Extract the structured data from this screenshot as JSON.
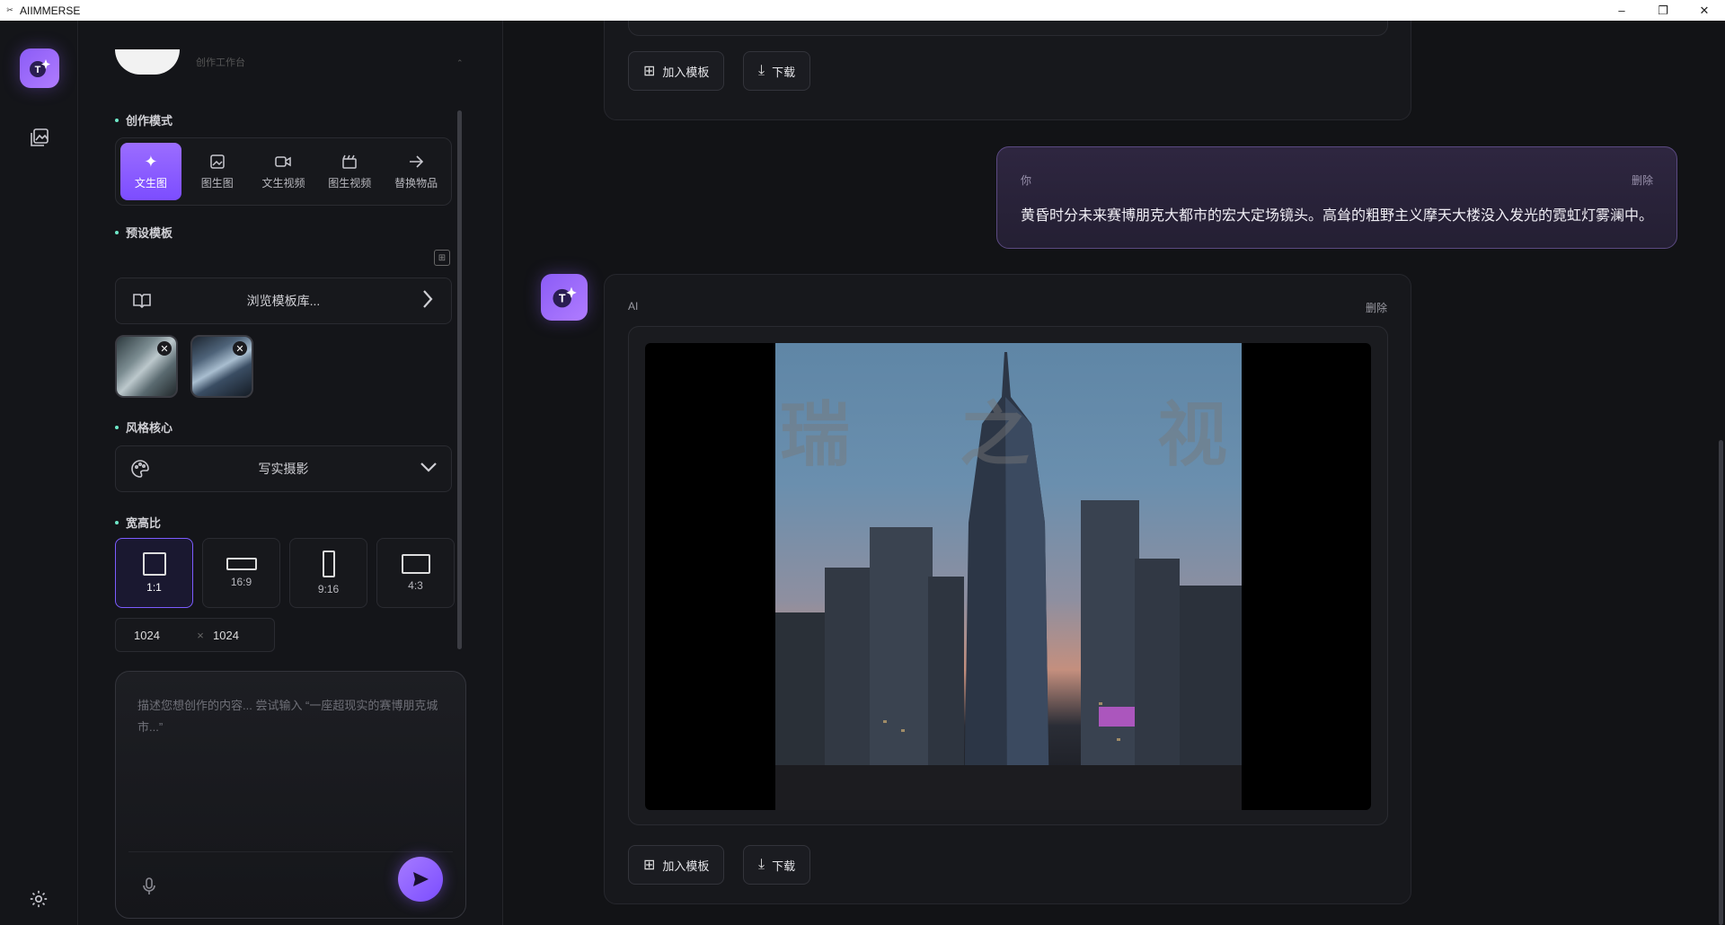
{
  "window": {
    "title": "AIIMMERSE",
    "controls": [
      "–",
      "❐",
      "✕"
    ]
  },
  "rail": {
    "logo_letter": "T",
    "icons": [
      "gallery-icon",
      "settings-icon"
    ]
  },
  "panel": {
    "top_label": "创作工作台",
    "modes_label": "创作模式",
    "modes": [
      {
        "label": "文生图",
        "icon": "✦",
        "active": true
      },
      {
        "label": "图生图",
        "icon": "▣",
        "active": false
      },
      {
        "label": "文生视频",
        "icon": "■",
        "active": false
      },
      {
        "label": "图生视频",
        "icon": "▤",
        "active": false
      },
      {
        "label": "替换物品",
        "icon": "→",
        "active": false
      }
    ],
    "templates_label": "预设模板",
    "browse_label": "浏览模板库...",
    "style_label": "风格核心",
    "style_value": "写实摄影",
    "ratio_label": "宽高比",
    "ratios": [
      {
        "label": "1:1",
        "active": true
      },
      {
        "label": "16:9",
        "active": false
      },
      {
        "label": "9:16",
        "active": false
      },
      {
        "label": "4:3",
        "active": false
      }
    ],
    "width": "1024",
    "times": "×",
    "height": "1024",
    "prompt_placeholder": "描述您想创作的内容... 尝试输入 “一座超现实的赛博朋克城市...”"
  },
  "chat": {
    "buttons": {
      "add_template": "加入模板",
      "download": "下载"
    },
    "user_message": {
      "who": "你",
      "delete": "删除",
      "text": "黄昏时分未来赛博朋克大都市的宏大定场镜头。高耸的粗野主义摩天大楼没入发光的霓虹灯雾澜中。"
    },
    "ai_message": {
      "who": "AI",
      "delete": "删除",
      "watermark": [
        "瑞",
        "之",
        "视"
      ]
    }
  },
  "colors": {
    "accent": "#8b5cf6",
    "background": "#121316",
    "panel": "#141519",
    "user_bubble": "#2e2640"
  }
}
